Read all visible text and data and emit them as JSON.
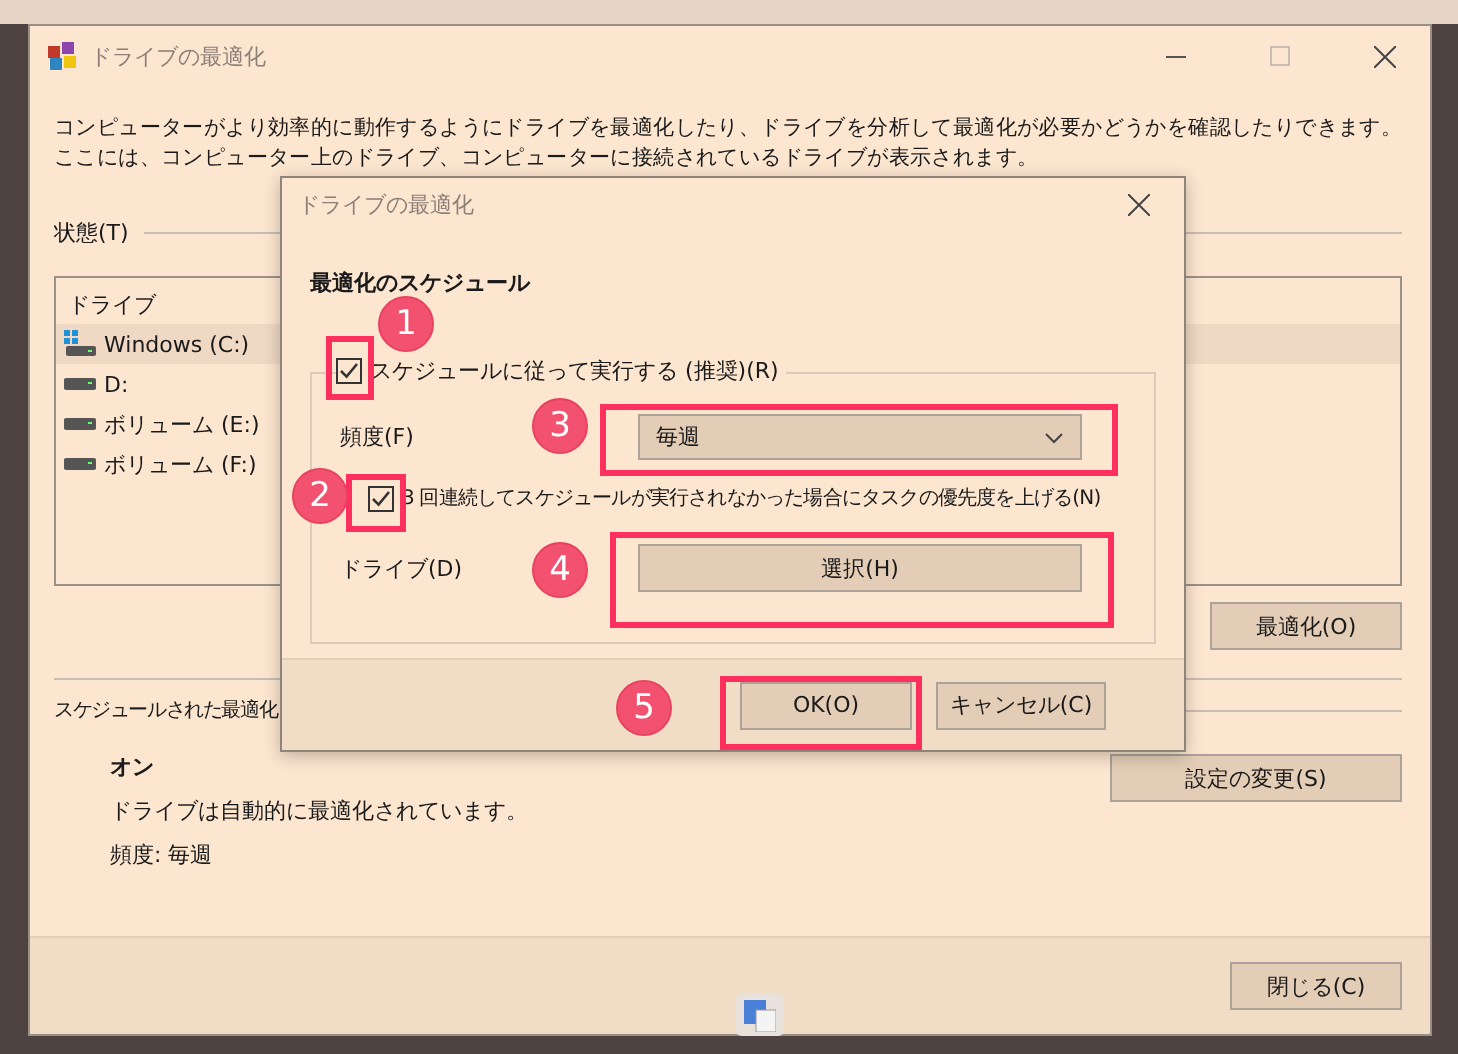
{
  "window": {
    "title": "ドライブの最適化",
    "description": "コンピューターがより効率的に動作するようにドライブを最適化したり、ドライブを分析して最適化が必要かどうかを確認したりできます。ここには、コンピューター上のドライブ、コンピューターに接続されているドライブが表示されます。"
  },
  "status": {
    "label": "状態(T)",
    "column": "ドライブ",
    "drives": [
      {
        "name": "Windows (C:)",
        "kind": "system",
        "selected": true
      },
      {
        "name": "D:",
        "kind": "disk",
        "selected": false
      },
      {
        "name": "ボリューム (E:)",
        "kind": "disk",
        "selected": false
      },
      {
        "name": "ボリューム (F:)",
        "kind": "disk",
        "selected": false
      }
    ],
    "optimize_button": "最適化(O)"
  },
  "scheduled": {
    "label": "スケジュールされた最適化",
    "state": "オン",
    "description": "ドライブは自動的に最適化されています。",
    "frequency": "頻度: 毎週",
    "change_button": "設定の変更(S)"
  },
  "close_button": "閉じる(C)",
  "dialog": {
    "title": "ドライブの最適化",
    "heading": "最適化のスケジュール",
    "schedule_checkbox": {
      "label": "スケジュールに従って実行する (推奨)(R)",
      "checked": true
    },
    "frequency": {
      "label": "頻度(F)",
      "value": "毎週"
    },
    "priority_checkbox": {
      "label": "3 回連続してスケジュールが実行されなかった場合にタスクの優先度を上げる(N)",
      "checked": true
    },
    "drives": {
      "label": "ドライブ(D)",
      "button": "選択(H)"
    },
    "buttons": [
      "OK(O)",
      "キャンセル(C)"
    ]
  },
  "annotations": [
    {
      "number": "1"
    },
    {
      "number": "2"
    },
    {
      "number": "3"
    },
    {
      "number": "4"
    },
    {
      "number": "5"
    }
  ]
}
